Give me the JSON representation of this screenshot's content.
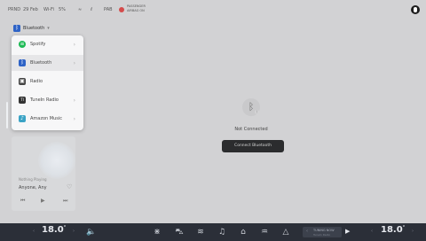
{
  "status_bar": {
    "items": [
      "PRND",
      "29 Feb",
      "Wi-Fi",
      "5%",
      "≈",
      "ℓ",
      "PAB"
    ],
    "notice_line1": "PASSENGER",
    "notice_line2": "AIRBAG ON"
  },
  "source_selector": {
    "icon": "bluetooth-icon",
    "label": "Bluetooth",
    "chevron": "▾"
  },
  "source_menu": {
    "items": [
      {
        "label": "Spotify",
        "icon": "spotify-icon",
        "color": "#1db954",
        "chevron": "›"
      },
      {
        "label": "Bluetooth",
        "icon": "bluetooth-icon",
        "color": "#2e63c6",
        "chevron": "›",
        "selected": true
      },
      {
        "label": "Radio",
        "icon": "radio-icon",
        "color": "#444444",
        "chevron": ""
      },
      {
        "label": "TuneIn Radio",
        "icon": "tunein-icon",
        "color": "#333333",
        "chevron": "›"
      },
      {
        "label": "Amazon Music",
        "icon": "amazon-music-icon",
        "color": "#3aa3c5",
        "chevron": "›"
      }
    ]
  },
  "mini_player": {
    "label": "Nothing Playing",
    "title": "Anyone, Any",
    "controls": [
      "⏮",
      "▶",
      "⏭"
    ]
  },
  "bluetooth_panel": {
    "status": "Not Connected",
    "button_label": "Connect Bluetooth"
  },
  "dock": {
    "driver_temp": "18.0",
    "passenger_temp": "18.0",
    "temp_unit": "°",
    "volume_icon": "volume-icon",
    "apps": [
      {
        "name": "climate-icon",
        "glyph": "⋇"
      },
      {
        "name": "car-icon",
        "glyph": "⛍"
      },
      {
        "name": "seat-heat-icon",
        "glyph": "≋"
      },
      {
        "name": "music-icon",
        "glyph": "♫"
      },
      {
        "name": "home-icon",
        "glyph": "⌂"
      },
      {
        "name": "defrost-icon",
        "glyph": "♒"
      },
      {
        "name": "navigation-icon",
        "glyph": "△"
      }
    ],
    "now_playing": {
      "title": "TUNING NOW",
      "subtitle": "TuneIn Radio"
    }
  },
  "colors": {
    "background": "#d2d2d4",
    "dock": "#2b2f38",
    "accent": "#2e63c6"
  }
}
